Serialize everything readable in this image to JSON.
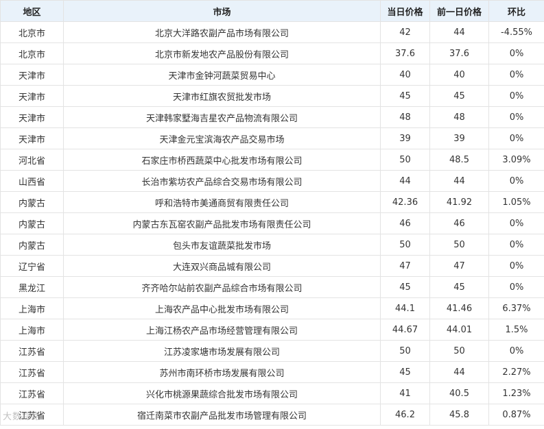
{
  "table": {
    "headers": [
      "地区",
      "市场",
      "当日价格",
      "前一日价格",
      "环比"
    ],
    "rows": [
      [
        "北京市",
        "北京大洋路农副产品市场有限公司",
        "42",
        "44",
        "-4.55%"
      ],
      [
        "北京市",
        "北京市新发地农产品股份有限公司",
        "37.6",
        "37.6",
        "0%"
      ],
      [
        "天津市",
        "天津市金钟河蔬菜贸易中心",
        "40",
        "40",
        "0%"
      ],
      [
        "天津市",
        "天津市红旗农贸批发市场",
        "45",
        "45",
        "0%"
      ],
      [
        "天津市",
        "天津韩家墅海吉星农产品物流有限公司",
        "48",
        "48",
        "0%"
      ],
      [
        "天津市",
        "天津金元宝滨海农产品交易市场",
        "39",
        "39",
        "0%"
      ],
      [
        "河北省",
        "石家庄市桥西蔬菜中心批发市场有限公司",
        "50",
        "48.5",
        "3.09%"
      ],
      [
        "山西省",
        "长治市紫坊农产品综合交易市场有限公司",
        "44",
        "44",
        "0%"
      ],
      [
        "内蒙古",
        "呼和浩特市美通商贸有限责任公司",
        "42.36",
        "41.92",
        "1.05%"
      ],
      [
        "内蒙古",
        "内蒙古东瓦窑农副产品批发市场有限责任公司",
        "46",
        "46",
        "0%"
      ],
      [
        "内蒙古",
        "包头市友谊蔬菜批发市场",
        "50",
        "50",
        "0%"
      ],
      [
        "辽宁省",
        "大连双兴商品城有限公司",
        "47",
        "47",
        "0%"
      ],
      [
        "黑龙江",
        "齐齐哈尔站前农副产品综合市场有限公司",
        "45",
        "45",
        "0%"
      ],
      [
        "上海市",
        "上海农产品中心批发市场有限公司",
        "44.1",
        "41.46",
        "6.37%"
      ],
      [
        "上海市",
        "上海江杨农产品市场经营管理有限公司",
        "44.67",
        "44.01",
        "1.5%"
      ],
      [
        "江苏省",
        "江苏凌家塘市场发展有限公司",
        "50",
        "50",
        "0%"
      ],
      [
        "江苏省",
        "苏州市南环桥市场发展有限公司",
        "45",
        "44",
        "2.27%"
      ],
      [
        "江苏省",
        "兴化市桃源果蔬综合批发市场有限公司",
        "41",
        "40.5",
        "1.23%"
      ],
      [
        "江苏省",
        "宿迁南菜市农副产品批发市场管理有限公司",
        "46.2",
        "45.8",
        "0.87%"
      ]
    ]
  },
  "watermark": "大数踪路"
}
